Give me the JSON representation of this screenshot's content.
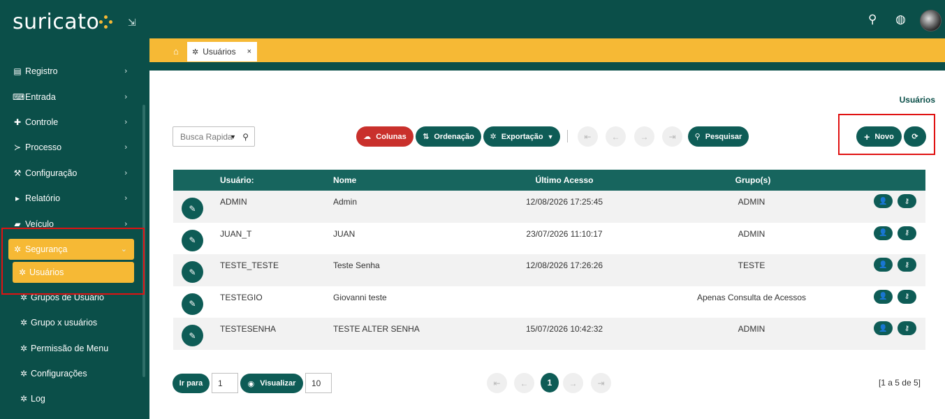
{
  "app": {
    "brand": "suricato",
    "brand_color": "#0b4f49",
    "accent_color": "#f6b935",
    "danger_color": "#c9302c"
  },
  "sidebar": {
    "collapse_icon": "compress-icon",
    "items": [
      {
        "label": "Registro",
        "icon": "book-icon"
      },
      {
        "label": "Entrada",
        "icon": "keyboard-icon"
      },
      {
        "label": "Controle",
        "icon": "puzzle-icon"
      },
      {
        "label": "Processo",
        "icon": "terminal-icon"
      },
      {
        "label": "Configuração",
        "icon": "wrench-icon"
      },
      {
        "label": "Relatório",
        "icon": "file-export-icon"
      },
      {
        "label": "Veículo",
        "icon": "car-icon"
      },
      {
        "label": "Segurança",
        "icon": "gear-icon"
      }
    ],
    "sub_items": [
      {
        "label": "Usuários"
      },
      {
        "label": "Grupos de Usuário"
      },
      {
        "label": "Grupo x usuários"
      },
      {
        "label": "Permissão de Menu"
      },
      {
        "label": "Configurações"
      },
      {
        "label": "Log"
      }
    ]
  },
  "topbar": {
    "icons": [
      "search-icon",
      "globe-icon",
      "avatar"
    ]
  },
  "tabs": [
    {
      "label": "Usuários",
      "close": "×"
    }
  ],
  "breadcrumb": "Usuários",
  "toolbar": {
    "search_placeholder": "Busca Rapida",
    "colunas": "Colunas",
    "ordenacao": "Ordenação",
    "exportacao": "Exportação",
    "pesquisar": "Pesquisar",
    "novo": "Novo"
  },
  "table": {
    "headers": [
      "Usuário:",
      "Nome",
      "Último Acesso",
      "Grupo(s)"
    ],
    "rows": [
      {
        "usuario": "ADMIN",
        "nome": "Admin",
        "ultimo_acesso": "12/08/2026 17:25:45",
        "grupos": "ADMIN"
      },
      {
        "usuario": "JUAN_T",
        "nome": "JUAN",
        "ultimo_acesso": "23/07/2026 11:10:17",
        "grupos": "ADMIN"
      },
      {
        "usuario": "TESTE_TESTE",
        "nome": "Teste Senha",
        "ultimo_acesso": "12/08/2026 17:26:26",
        "grupos": "TESTE"
      },
      {
        "usuario": "TESTEGIO",
        "nome": "Giovanni teste",
        "ultimo_acesso": "",
        "grupos": "Apenas Consulta de Acessos"
      },
      {
        "usuario": "TESTESENHA",
        "nome": "TESTE ALTER SENHA",
        "ultimo_acesso": "15/07/2026 10:42:32",
        "grupos": "ADMIN"
      }
    ]
  },
  "footer": {
    "ir_para": "Ir para",
    "ir_para_value": "1",
    "visualizar": "Visualizar",
    "visualizar_value": "10",
    "current_page": "1",
    "page_info": "[1 a 5 de 5]"
  }
}
